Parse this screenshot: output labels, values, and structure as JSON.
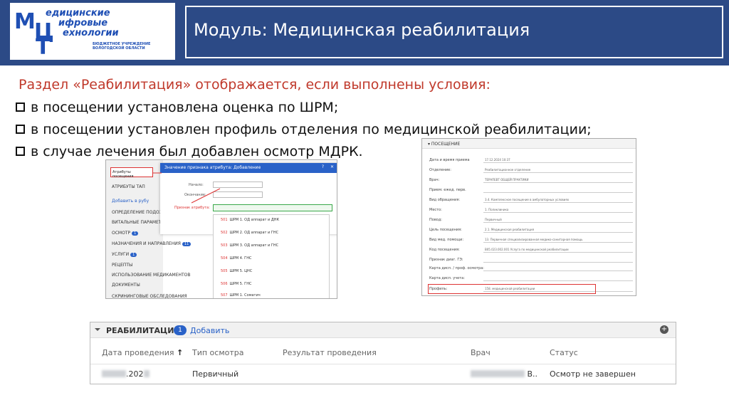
{
  "logo": {
    "letters": [
      "М",
      "Ц",
      "Т"
    ],
    "line1": "едицинские",
    "line2": "ифровые",
    "line3": "ехнологии",
    "small": "БЮДЖЕТНОЕ УЧРЕЖДЕНИЕ ВОЛОГОДСКОЙ ОБЛАСТИ"
  },
  "header": {
    "title": "Модуль: Медицинская реабилитация"
  },
  "intro": "Раздел «Реабилитация» отображается, если выполнены условия:",
  "conditions": [
    "в посещении установлена оценка по ШРМ;",
    "в посещении установлен профиль отделения по медицинской реабилитации;",
    "в случае лечения был добавлен осмотр МДРК."
  ],
  "left_shot": {
    "attr_button": "Атрибуты посещения",
    "dialog_title": "Значение признака атрибута: Добавление",
    "labels": [
      "Начало:",
      "Окончание:",
      "Признак атрибута:"
    ],
    "nav": [
      "АТРИБУТЫ ТАП",
      "Добавить в рубу",
      "ОПРЕДЕЛЕНИЕ ПОДОЗ",
      "ВИТАЛЬНЫЕ ПАРАМЕТР",
      "ОСМОТР",
      "НАЗНАЧЕНИЯ И НАПРАВЛЕНИЯ",
      "УСЛУГИ",
      "РЕЦЕПТЫ",
      "ИСПОЛЬЗОВАНИЕ МЕДИКАМЕНТОВ",
      "ДОКУМЕНТЫ",
      "СКРИНИНГОВЫЕ ОБСЛЕДОВАНИЯ"
    ],
    "nav_badges": {
      "osmotr": "1",
      "nazn": "11",
      "uslugi": "1"
    },
    "options": [
      {
        "num": "501",
        "text": "ШРМ 1. ОД аппарат и ДНК"
      },
      {
        "num": "502",
        "text": "ШРМ 2. ОД аппарат и ГНС"
      },
      {
        "num": "503",
        "text": "ШРМ 3. ОД аппарат и ГНС"
      },
      {
        "num": "504",
        "text": "ШРМ 4. ГНС"
      },
      {
        "num": "505",
        "text": "ШРМ 5. ЦНС"
      },
      {
        "num": "506",
        "text": "ШРМ 5. ГНС"
      },
      {
        "num": "507",
        "text": "ШРМ 1. Соматич"
      }
    ]
  },
  "right_shot": {
    "section": "ПОСЕЩЕНИЕ",
    "rows": [
      {
        "label": "Дата и время приема",
        "value": "17.12.2024   10:37"
      },
      {
        "label": "Отделение:",
        "value": "Реабилитационное отделение"
      },
      {
        "label": "Врач:",
        "value": "ТЕРАПЕВТ ОБЩЕЙ ПРАКТИКИ"
      },
      {
        "label": "Прием: ежед. перв.",
        "value": ""
      },
      {
        "label": "Вид обращения:",
        "value": "3.4. Комплексное посещение в амбулаторных условиях"
      },
      {
        "label": "Место:",
        "value": "1. Поликлиника"
      },
      {
        "label": "Повод:",
        "value": "Первичный"
      },
      {
        "label": "Цель посещения:",
        "value": "2.1. Медицинская реабилитация"
      },
      {
        "label": "Вид мед. помощи:",
        "value": "13. Первичная специализированная медико-санитарная помощь"
      },
      {
        "label": "Код посещения:",
        "value": "B05.023.002.001 Услуга по медицинской реабилитации"
      },
      {
        "label": "Признак диаг. ГЭ:",
        "value": ""
      },
      {
        "label": "Карта дисп. / проф. осмотра:",
        "value": ""
      },
      {
        "label": "Карта дисп. учета:",
        "value": ""
      },
      {
        "label": "Профиль:",
        "value": "158. медицинской реабилитации"
      }
    ]
  },
  "rehab_panel": {
    "title": "РЕАБИЛИТАЦИЯ",
    "count": "1",
    "add_label": "Добавить",
    "columns": [
      "Дата проведения",
      "Тип осмотра",
      "Результат проведения",
      "Врач",
      "Статус"
    ],
    "row": {
      "date_suffix": ".202",
      "type": "Первичный",
      "result": "",
      "doctor_suffix": "В..",
      "status": "Осмотр не завершен"
    }
  }
}
